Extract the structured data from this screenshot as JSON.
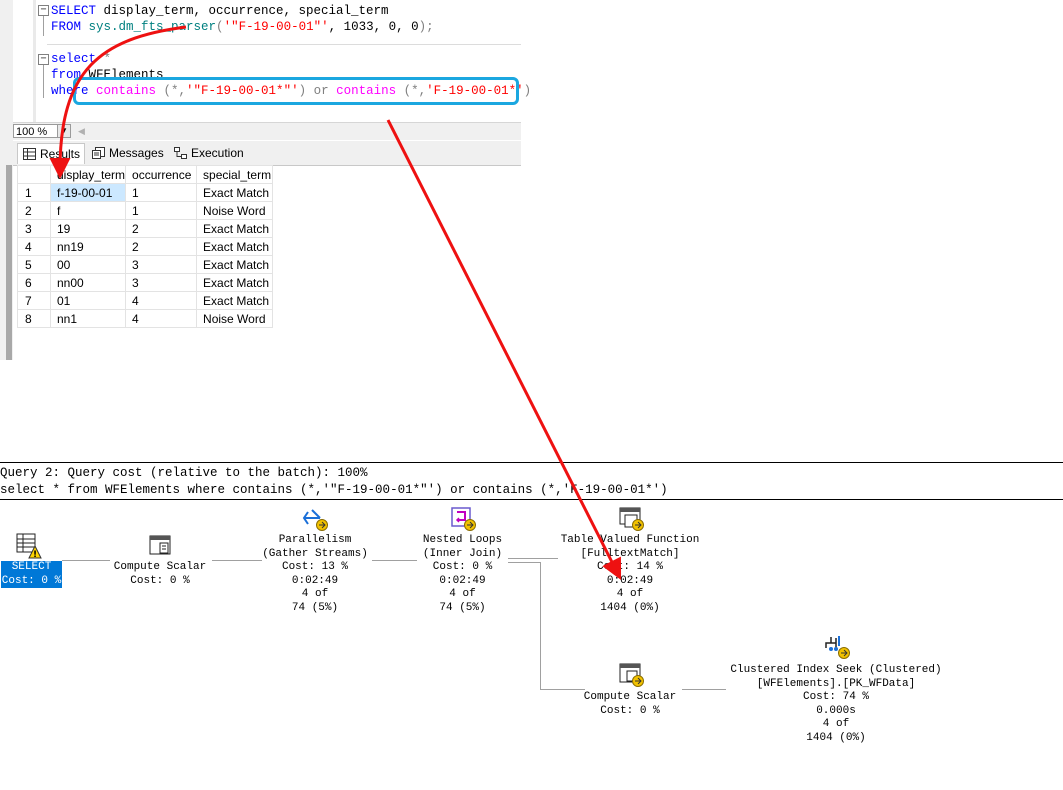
{
  "editor": {
    "lines": [
      {
        "parts": [
          {
            "t": "SELECT",
            "c": "kw"
          },
          {
            "t": " display_term, occurrence, special_term",
            "c": ""
          }
        ]
      },
      {
        "parts": [
          {
            "t": "FROM ",
            "c": "kw"
          },
          {
            "t": "sys.dm_fts_parser",
            "c": "teal"
          },
          {
            "t": "(",
            "c": "gray"
          },
          {
            "t": "'\"F-19-00-01\"'",
            "c": "str"
          },
          {
            "t": ", 1033, 0, 0",
            "c": ""
          },
          {
            "t": ");",
            "c": "gray"
          }
        ]
      },
      {
        "parts": [
          {
            "t": "select",
            "c": "kw"
          },
          {
            "t": " *",
            "c": "gray"
          }
        ]
      },
      {
        "parts": [
          {
            "t": "from",
            "c": "kw"
          },
          {
            "t": " WFElements",
            "c": ""
          }
        ]
      },
      {
        "parts": [
          {
            "t": "where ",
            "c": "kw"
          },
          {
            "t": "contains",
            "c": "fn"
          },
          {
            "t": " (*,",
            "c": "gray"
          },
          {
            "t": "'\"F-19-00-01*\"'",
            "c": "str"
          },
          {
            "t": ") ",
            "c": "gray"
          },
          {
            "t": "or",
            "c": "gray"
          },
          {
            "t": " contains",
            "c": "fn"
          },
          {
            "t": " (*,",
            "c": "gray"
          },
          {
            "t": "'F-19-00-01*'",
            "c": "str"
          },
          {
            "t": ")",
            "c": "gray"
          }
        ]
      }
    ]
  },
  "zoom": {
    "value": "100 %"
  },
  "tabs": [
    {
      "label": "Results",
      "icon": "grid-icon"
    },
    {
      "label": "Messages",
      "icon": "messages-icon"
    },
    {
      "label": "Execution plan",
      "icon": "execution-plan-icon"
    }
  ],
  "results": {
    "columns": [
      "display_term",
      "occurrence",
      "special_term"
    ],
    "rows": [
      [
        "1",
        "f-19-00-01",
        "1",
        "Exact Match"
      ],
      [
        "2",
        "f",
        "1",
        "Noise Word"
      ],
      [
        "3",
        "19",
        "2",
        "Exact Match"
      ],
      [
        "4",
        "nn19",
        "2",
        "Exact Match"
      ],
      [
        "5",
        "00",
        "3",
        "Exact Match"
      ],
      [
        "6",
        "nn00",
        "3",
        "Exact Match"
      ],
      [
        "7",
        "01",
        "4",
        "Exact Match"
      ],
      [
        "8",
        "nn1",
        "4",
        "Noise Word"
      ]
    ]
  },
  "plan": {
    "header_line1": "Query 2: Query cost (relative to the batch): 100%",
    "header_line2": "select * from WFElements where contains (*,'\"F-19-00-01*\"') or contains (*,'F-19-00-01*')",
    "nodes": {
      "select": {
        "line1": "SELECT",
        "line2": "Cost: 0 %"
      },
      "compute_scalar_1": {
        "text": "Compute Scalar\nCost: 0 %"
      },
      "parallelism": {
        "text": "Parallelism\n(Gather Streams)\nCost: 13 %\n0:02:49\n4 of\n74 (5%)"
      },
      "nested_loops": {
        "text": "Nested Loops\n(Inner Join)\nCost: 0 %\n0:02:49\n4 of\n74 (5%)"
      },
      "table_valued_function": {
        "text": "Table Valued Function\n[FulltextMatch]\nCost: 14 %\n0:02:49\n4 of\n1404 (0%)"
      },
      "compute_scalar_2": {
        "text": "Compute Scalar\nCost: 0 %"
      },
      "clustered_index_seek": {
        "text": "Clustered Index Seek (Clustered)\n[WFElements].[PK_WFData]\nCost: 74 %\n0.000s\n4 of\n1404 (0%)"
      }
    }
  },
  "colors": {
    "annotation_arrow": "#ee1111",
    "highlight_box": "#1ba7e0",
    "selected_node": "#0078d7"
  }
}
